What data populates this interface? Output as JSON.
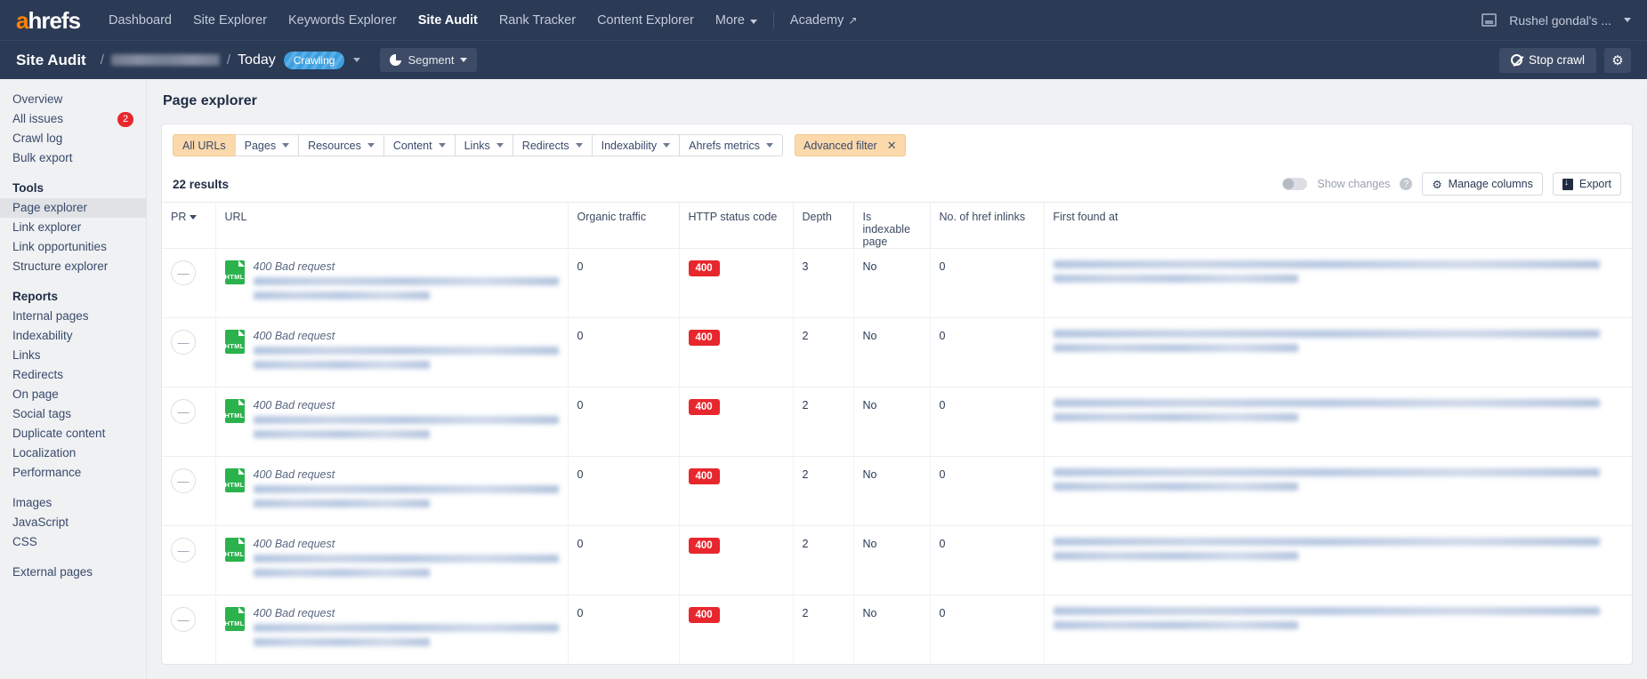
{
  "topnav": {
    "logo": "ahrefs",
    "links": [
      {
        "label": "Dashboard",
        "active": false
      },
      {
        "label": "Site Explorer",
        "active": false
      },
      {
        "label": "Keywords Explorer",
        "active": false
      },
      {
        "label": "Site Audit",
        "active": true
      },
      {
        "label": "Rank Tracker",
        "active": false
      },
      {
        "label": "Content Explorer",
        "active": false
      },
      {
        "label": "More",
        "active": false
      }
    ],
    "academy": "Academy",
    "academy_icon": "external-link-icon",
    "inbox_icon": "inbox-icon",
    "username": "Rushel gondal's ...",
    "user_caret_icon": "chevron-down-icon"
  },
  "subheader": {
    "title": "Site Audit",
    "separator": "/",
    "project_redacted": "",
    "date": "Today",
    "status": "Crawling",
    "status_color": "#3b9fe0",
    "status_caret_icon": "chevron-down-icon",
    "segment_label": "Segment",
    "segment_icon": "pie-chart-icon",
    "stop_crawl_label": "Stop crawl",
    "stop_icon": "no-entry-icon",
    "settings_icon": "gear-icon"
  },
  "sidebar": {
    "items": [
      {
        "label": "Overview",
        "type": "item",
        "selected": false,
        "badge": null
      },
      {
        "label": "All issues",
        "type": "item",
        "selected": false,
        "badge": "2"
      },
      {
        "label": "Crawl log",
        "type": "item",
        "selected": false,
        "badge": null
      },
      {
        "label": "Bulk export",
        "type": "item",
        "selected": false,
        "badge": null
      },
      {
        "label": "Tools",
        "type": "head"
      },
      {
        "label": "Page explorer",
        "type": "item",
        "selected": true,
        "badge": null
      },
      {
        "label": "Link explorer",
        "type": "item",
        "selected": false,
        "badge": null
      },
      {
        "label": "Link opportunities",
        "type": "item",
        "selected": false,
        "badge": null
      },
      {
        "label": "Structure explorer",
        "type": "item",
        "selected": false,
        "badge": null
      },
      {
        "label": "Reports",
        "type": "head"
      },
      {
        "label": "Internal pages",
        "type": "item",
        "selected": false,
        "badge": null
      },
      {
        "label": "Indexability",
        "type": "item",
        "selected": false,
        "badge": null
      },
      {
        "label": "Links",
        "type": "item",
        "selected": false,
        "badge": null
      },
      {
        "label": "Redirects",
        "type": "item",
        "selected": false,
        "badge": null
      },
      {
        "label": "On page",
        "type": "item",
        "selected": false,
        "badge": null
      },
      {
        "label": "Social tags",
        "type": "item",
        "selected": false,
        "badge": null
      },
      {
        "label": "Duplicate content",
        "type": "item",
        "selected": false,
        "badge": null
      },
      {
        "label": "Localization",
        "type": "item",
        "selected": false,
        "badge": null
      },
      {
        "label": "Performance",
        "type": "item",
        "selected": false,
        "badge": null
      },
      {
        "label": "",
        "type": "gap"
      },
      {
        "label": "Images",
        "type": "item",
        "selected": false,
        "badge": null
      },
      {
        "label": "JavaScript",
        "type": "item",
        "selected": false,
        "badge": null
      },
      {
        "label": "CSS",
        "type": "item",
        "selected": false,
        "badge": null
      },
      {
        "label": "",
        "type": "gap"
      },
      {
        "label": "External pages",
        "type": "item",
        "selected": false,
        "badge": null
      }
    ]
  },
  "main": {
    "page_title": "Page explorer",
    "filters": [
      {
        "label": "All URLs",
        "caret": false,
        "active": true
      },
      {
        "label": "Pages",
        "caret": true,
        "active": false
      },
      {
        "label": "Resources",
        "caret": true,
        "active": false
      },
      {
        "label": "Content",
        "caret": true,
        "active": false
      },
      {
        "label": "Links",
        "caret": true,
        "active": false
      },
      {
        "label": "Redirects",
        "caret": true,
        "active": false
      },
      {
        "label": "Indexability",
        "caret": true,
        "active": false
      },
      {
        "label": "Ahrefs metrics",
        "caret": true,
        "active": false
      }
    ],
    "advanced_filter": {
      "label": "Advanced filter",
      "close_icon": "close-icon"
    },
    "toolbar": {
      "results": "22 results",
      "show_changes": "Show changes",
      "show_changes_on": false,
      "help_icon": "question-mark-icon",
      "manage_columns": "Manage columns",
      "manage_columns_icon": "gear-icon",
      "export": "Export",
      "export_icon": "download-icon"
    },
    "table": {
      "columns": [
        {
          "label": "PR",
          "sorted": true
        },
        {
          "label": "URL",
          "sorted": false
        },
        {
          "label": "Organic traffic",
          "sorted": false
        },
        {
          "label": "HTTP status code",
          "sorted": false
        },
        {
          "label": "Depth",
          "sorted": false
        },
        {
          "label": "Is indexable page",
          "sorted": false
        },
        {
          "label": "No. of href inlinks",
          "sorted": false
        },
        {
          "label": "First found at",
          "sorted": false
        }
      ],
      "rows": [
        {
          "pr": "—",
          "file_type": "HTML",
          "title": "400 Bad request",
          "organic_traffic": "0",
          "http_status": "400",
          "depth": "3",
          "is_indexable": "No",
          "inlinks": "0"
        },
        {
          "pr": "—",
          "file_type": "HTML",
          "title": "400 Bad request",
          "organic_traffic": "0",
          "http_status": "400",
          "depth": "2",
          "is_indexable": "No",
          "inlinks": "0"
        },
        {
          "pr": "—",
          "file_type": "HTML",
          "title": "400 Bad request",
          "organic_traffic": "0",
          "http_status": "400",
          "depth": "2",
          "is_indexable": "No",
          "inlinks": "0"
        },
        {
          "pr": "—",
          "file_type": "HTML",
          "title": "400 Bad request",
          "organic_traffic": "0",
          "http_status": "400",
          "depth": "2",
          "is_indexable": "No",
          "inlinks": "0"
        },
        {
          "pr": "—",
          "file_type": "HTML",
          "title": "400 Bad request",
          "organic_traffic": "0",
          "http_status": "400",
          "depth": "2",
          "is_indexable": "No",
          "inlinks": "0"
        },
        {
          "pr": "—",
          "file_type": "HTML",
          "title": "400 Bad request",
          "organic_traffic": "0",
          "http_status": "400",
          "depth": "2",
          "is_indexable": "No",
          "inlinks": "0"
        }
      ]
    }
  }
}
